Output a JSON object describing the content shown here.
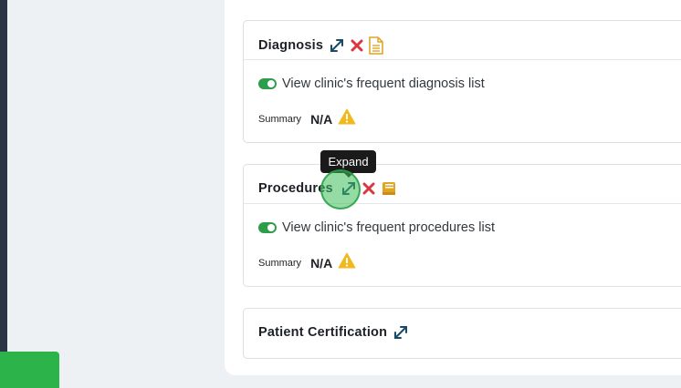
{
  "colors": {
    "accent_green": "#2e9d4a",
    "expand_icon": "#1a4a66",
    "delete_icon": "#d9363e",
    "doc_icon": "#e0a526",
    "warning": "#f1b91c"
  },
  "diagnosis": {
    "title": "Diagnosis",
    "icons": [
      "expand-icon",
      "delete-icon",
      "document-icon"
    ],
    "toggle_label": "View clinic's frequent diagnosis list",
    "summary_label": "Summary",
    "summary_value": "N/A"
  },
  "procedures": {
    "title": "Procedures",
    "icons": [
      "expand-icon",
      "delete-icon",
      "book-icon"
    ],
    "toggle_label": "View clinic's frequent procedures list",
    "summary_label": "Summary",
    "summary_value": "N/A"
  },
  "certification": {
    "title": "Patient Certification",
    "icons": [
      "expand-icon"
    ]
  },
  "tooltip": {
    "text": "Expand"
  }
}
